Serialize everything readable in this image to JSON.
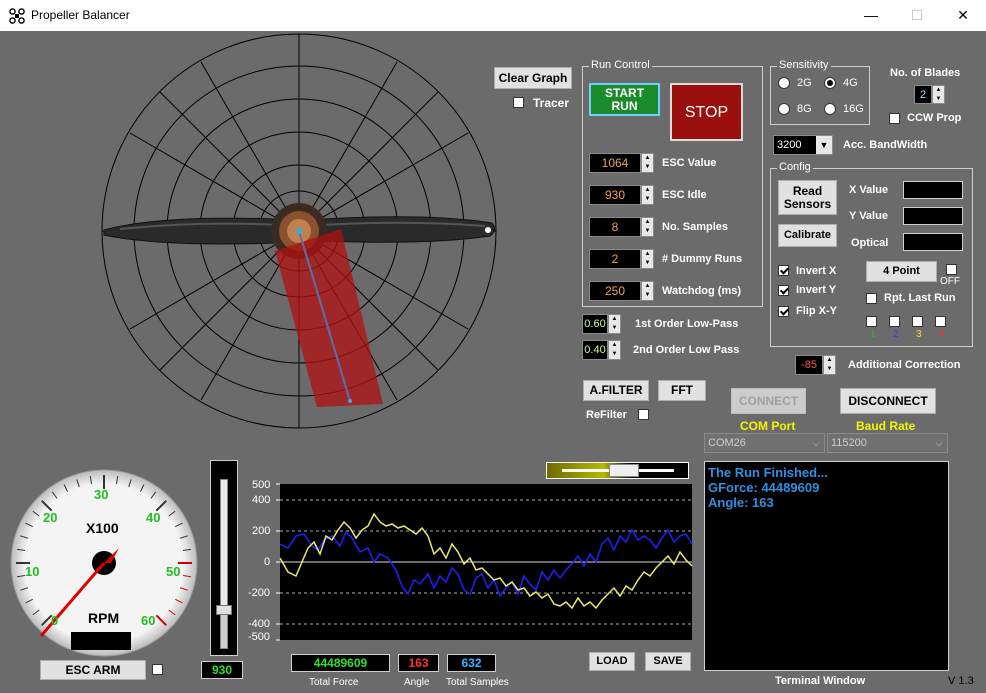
{
  "window": {
    "title": "Propeller Balancer",
    "minimize": "—",
    "maximize": "☐",
    "close": "✕"
  },
  "graph": {
    "clear_label": "Clear Graph",
    "tracer_label": "Tracer",
    "tracer_checked": false
  },
  "run_control": {
    "title": "Run Control",
    "start_label": "START RUN",
    "stop_label": "STOP",
    "esc_value": {
      "label": "ESC Value",
      "value": "1064"
    },
    "esc_idle": {
      "label": "ESC Idle",
      "value": "930"
    },
    "samples": {
      "label": "No. Samples",
      "value": "8"
    },
    "dummy_runs": {
      "label": "# Dummy Runs",
      "value": "2"
    },
    "watchdog": {
      "label": "Watchdog (ms)",
      "value": "250"
    }
  },
  "filters": {
    "first_order": {
      "label": "1st Order Low-Pass",
      "value": "0.60"
    },
    "second_order": {
      "label": "2nd Order Low Pass",
      "value": "0.40"
    },
    "afilter_label": "A.FILTER",
    "fft_label": "FFT",
    "refilter_label": "ReFilter",
    "refilter_checked": false
  },
  "sensitivity": {
    "title": "Sensitivity",
    "options": [
      "2G",
      "4G",
      "8G",
      "16G"
    ],
    "selected": "4G"
  },
  "blades": {
    "label": "No. of Blades",
    "value": "2",
    "ccw_label": "CCW Prop",
    "ccw_checked": false
  },
  "bandwidth": {
    "value": "3200",
    "label": "Acc. BandWidth"
  },
  "config": {
    "title": "Config",
    "read_sensors_label": "Read Sensors",
    "calibrate_label": "Calibrate",
    "x_value_label": "X Value",
    "y_value_label": "Y Value",
    "optical_label": "Optical",
    "invert_x": {
      "label": "Invert X",
      "checked": true
    },
    "invert_y": {
      "label": "Invert Y",
      "checked": true
    },
    "flip_xy": {
      "label": "Flip X-Y",
      "checked": true
    },
    "four_point_label": "4 Point",
    "off_label": "OFF",
    "rpt_last_run_label": "Rpt. Last Run",
    "points": [
      {
        "label": "1",
        "color": "#1fbf1f"
      },
      {
        "label": "2",
        "color": "#2f3fff"
      },
      {
        "label": "3",
        "color": "#f0e020"
      },
      {
        "label": "4",
        "color": "#ff3030"
      }
    ]
  },
  "correction": {
    "value": "-85",
    "label": "Additional Correction"
  },
  "connection": {
    "connect_label": "CONNECT",
    "disconnect_label": "DISCONNECT",
    "com_port_label": "COM Port",
    "com_port_value": "COM26",
    "baud_rate_label": "Baud Rate",
    "baud_rate_value": "115200"
  },
  "terminal": {
    "lines": [
      "The Run Finished...",
      "GForce: 44489609",
      "Angle: 163"
    ],
    "caption": "Terminal Window"
  },
  "gauge": {
    "center_label": "X100",
    "unit_label": "RPM",
    "ticks": [
      "0",
      "10",
      "20",
      "30",
      "40",
      "50",
      "60"
    ],
    "esc_arm_label": "ESC ARM",
    "esc_arm_checked": false
  },
  "throttle": {
    "value": "930"
  },
  "plot": {
    "y_ticks": [
      "500",
      "400",
      "200",
      "0",
      "-200",
      "-400",
      "-500"
    ],
    "load_label": "LOAD",
    "save_label": "SAVE"
  },
  "results": {
    "total_force": {
      "value": "44489609",
      "caption": "Total Force",
      "color": "#2fe02f"
    },
    "angle": {
      "value": "163",
      "caption": "Angle",
      "color": "#ff3030"
    },
    "total_samples": {
      "value": "632",
      "caption": "Total Samples",
      "color": "#40b0ff"
    }
  },
  "version": "V 1.3",
  "colors": {
    "background": "#6b6b6b",
    "start": "#1a8a2a",
    "stop": "#9b0f0f",
    "accent_yellow": "#f5f500"
  }
}
